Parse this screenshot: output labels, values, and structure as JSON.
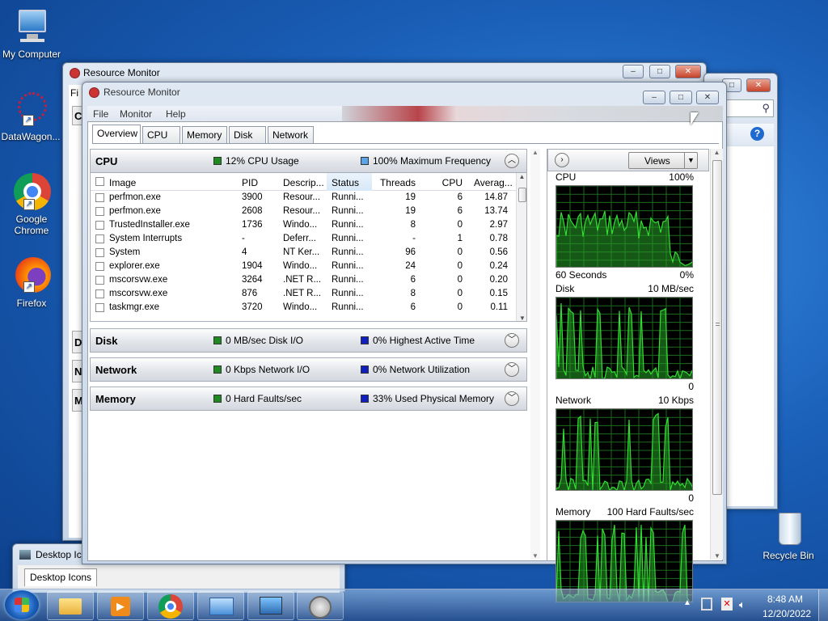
{
  "desktop": {
    "icons": [
      {
        "label": "My Computer"
      },
      {
        "label": "DataWagon..."
      },
      {
        "label": "Google Chrome"
      },
      {
        "label": "Firefox"
      },
      {
        "label": "Recycle Bin"
      }
    ]
  },
  "back_window": {
    "title": "Resource Monitor",
    "menu_first": "Fi"
  },
  "desktop_icons_window": {
    "title": "Desktop Ico",
    "tab": "Desktop Icons"
  },
  "window": {
    "title": "Resource Monitor",
    "menu": [
      "File",
      "Monitor",
      "Help"
    ],
    "tabs": [
      "Overview",
      "CPU",
      "Memory",
      "Disk",
      "Network"
    ],
    "sections": {
      "cpu": {
        "title": "CPU",
        "stat1": "12% CPU Usage",
        "stat2": "100% Maximum Frequency",
        "stat1_color": "#1f8a1f",
        "stat2_color": "#5aa5e8"
      },
      "disk": {
        "title": "Disk",
        "stat1": "0 MB/sec Disk I/O",
        "stat2": "0% Highest Active Time",
        "stat1_color": "#1f8a1f",
        "stat2_color": "#1020c0"
      },
      "network": {
        "title": "Network",
        "stat1": "0 Kbps Network I/O",
        "stat2": "0% Network Utilization",
        "stat1_color": "#1f8a1f",
        "stat2_color": "#1020c0"
      },
      "memory": {
        "title": "Memory",
        "stat1": "0 Hard Faults/sec",
        "stat2": "33% Used Physical Memory",
        "stat1_color": "#1f8a1f",
        "stat2_color": "#1020c0"
      }
    },
    "table": {
      "headers": [
        "Image",
        "PID",
        "Descrip...",
        "Status",
        "Threads",
        "CPU",
        "Averag..."
      ],
      "rows": [
        [
          "perfmon.exe",
          "3900",
          "Resour...",
          "Runni...",
          "19",
          "6",
          "14.87"
        ],
        [
          "perfmon.exe",
          "2608",
          "Resour...",
          "Runni...",
          "19",
          "6",
          "13.74"
        ],
        [
          "TrustedInstaller.exe",
          "1736",
          "Windo...",
          "Runni...",
          "8",
          "0",
          "2.97"
        ],
        [
          "System Interrupts",
          "-",
          "Deferr...",
          "Runni...",
          "-",
          "1",
          "0.78"
        ],
        [
          "System",
          "4",
          "NT Ker...",
          "Runni...",
          "96",
          "0",
          "0.56"
        ],
        [
          "explorer.exe",
          "1904",
          "Windo...",
          "Runni...",
          "24",
          "0",
          "0.24"
        ],
        [
          "mscorsvw.exe",
          "3264",
          ".NET R...",
          "Runni...",
          "6",
          "0",
          "0.20"
        ],
        [
          "mscorsvw.exe",
          "876",
          ".NET R...",
          "Runni...",
          "8",
          "0",
          "0.15"
        ],
        [
          "taskmgr.exe",
          "3720",
          "Windo...",
          "Runni...",
          "6",
          "0",
          "0.11"
        ]
      ]
    },
    "right_panel": {
      "views_label": "Views",
      "graphs": [
        {
          "name": "CPU",
          "max": "100%",
          "bottom_left": "60 Seconds",
          "bottom_right": "0%"
        },
        {
          "name": "Disk",
          "max": "10 MB/sec",
          "bottom_left": "",
          "bottom_right": "0"
        },
        {
          "name": "Network",
          "max": "10 Kbps",
          "bottom_left": "",
          "bottom_right": "0"
        },
        {
          "name": "Memory",
          "max": "100 Hard Faults/sec",
          "bottom_left": "",
          "bottom_right": ""
        }
      ]
    }
  },
  "taskbar": {
    "time": "8:48 AM",
    "date": "12/20/2022"
  },
  "colors": {
    "graph_line": "#33dd33",
    "graph_grid": "#1d6b1d"
  }
}
